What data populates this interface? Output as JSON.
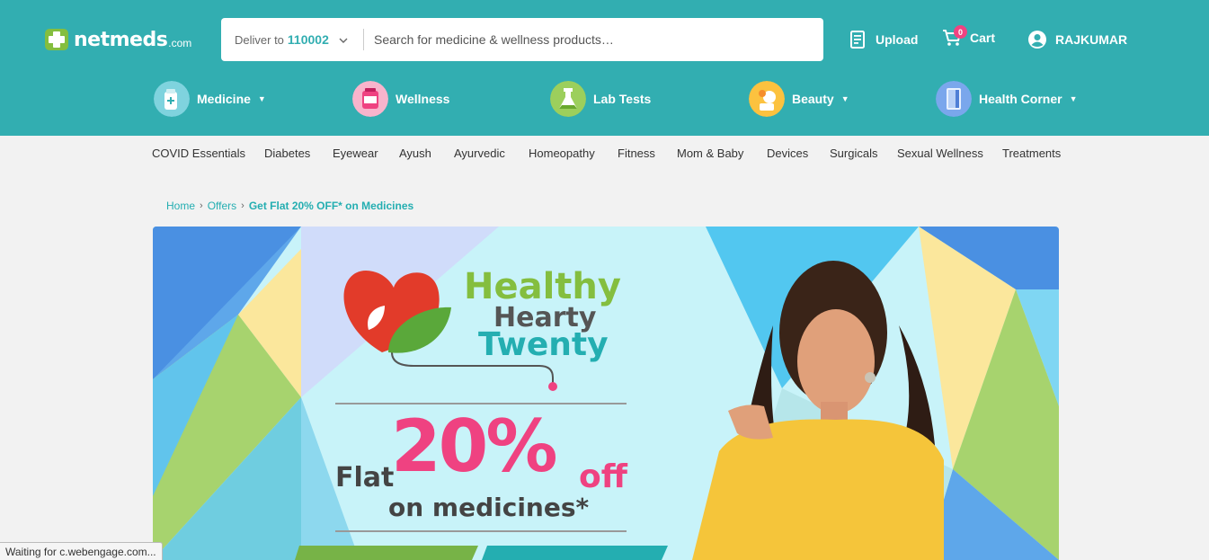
{
  "brand": {
    "name": "netmeds",
    "tld": ".com"
  },
  "search": {
    "deliver_label": "Deliver to",
    "pincode": "110002",
    "placeholder": "Search for medicine & wellness products…"
  },
  "header_actions": {
    "upload": "Upload",
    "cart": "Cart",
    "cart_count": "0",
    "user": "RAJKUMAR"
  },
  "categories": [
    {
      "label": "Medicine",
      "has_dropdown": true
    },
    {
      "label": "Wellness",
      "has_dropdown": false
    },
    {
      "label": "Lab Tests",
      "has_dropdown": false
    },
    {
      "label": "Beauty",
      "has_dropdown": true
    },
    {
      "label": "Health Corner",
      "has_dropdown": true
    }
  ],
  "subnav": [
    "COVID Essentials",
    "Diabetes",
    "Eyewear",
    "Ayush",
    "Ayurvedic",
    "Homeopathy",
    "Fitness",
    "Mom & Baby",
    "Devices",
    "Surgicals",
    "Sexual Wellness",
    "Treatments"
  ],
  "breadcrumb": {
    "home": "Home",
    "offers": "Offers",
    "current": "Get Flat 20% OFF* on Medicines"
  },
  "banner": {
    "line1": "Healthy",
    "line2": "Hearty",
    "line3": "Twenty",
    "flat": "Flat",
    "percent": "20%",
    "off": "off",
    "on_medicines": "on medicines*"
  },
  "status_bar": "Waiting for c.webengage.com...",
  "colors": {
    "header": "#32aeb1",
    "accent_pink": "#ef4281",
    "green": "#84be3f",
    "teal": "#24aeb1"
  }
}
